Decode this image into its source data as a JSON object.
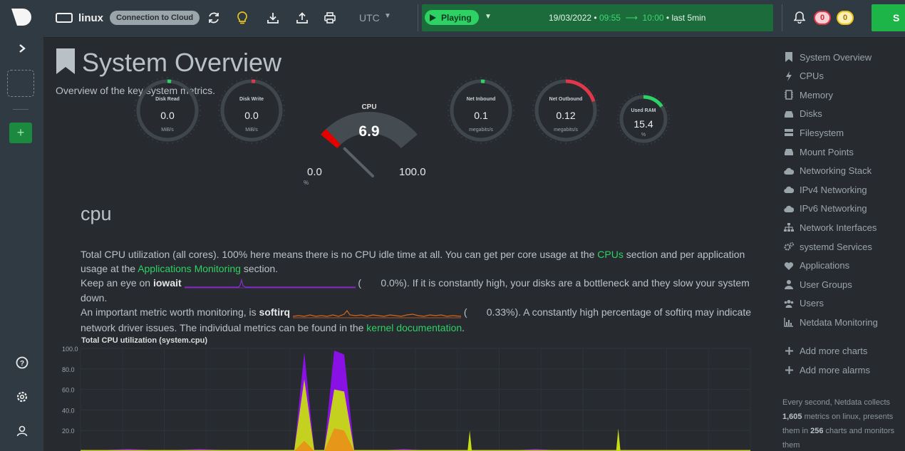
{
  "topbar": {
    "host": "linux",
    "cloud_badge": "Connection to Cloud",
    "timezone": "UTC",
    "play_label": "Playing",
    "date": "19/03/2022",
    "time_from": "09:55",
    "time_to": "10:00",
    "range": "last 5min",
    "alarms_critical": "0",
    "alarms_warning": "0",
    "signin_label": "S"
  },
  "colors": {
    "accent": "#2ed163",
    "critical": "#e0384a",
    "warning": "#e8c41c",
    "background": "#272b30"
  },
  "page": {
    "title": "System Overview",
    "subtitle": "Overview of the key system metrics."
  },
  "gauges": [
    {
      "label": "Disk Read",
      "value": "0.0",
      "unit": "MiB/s",
      "level": 0.0,
      "color": "#2ed163"
    },
    {
      "label": "Disk Write",
      "value": "0.0",
      "unit": "MiB/s",
      "level": 0.0,
      "color": "#e0384a"
    },
    {
      "label": "Net Inbound",
      "value": "0.1",
      "unit": "megabits/s",
      "level": 0.0,
      "color": "#2ed163"
    },
    {
      "label": "Net Outbound",
      "value": "0.12",
      "unit": "megabits/s",
      "level": 0.2,
      "color": "#e0384a"
    },
    {
      "label": "Used RAM",
      "value": "15.4",
      "unit": "%",
      "level": 0.154,
      "color": "#2ed163"
    }
  ],
  "cpu_gauge": {
    "label": "CPU",
    "value": "6.9",
    "min": "0.0",
    "max": "100.0",
    "unit": "%",
    "level": 0.069
  },
  "section": {
    "title": "cpu",
    "p1_a": "Total CPU utilization (all cores). 100% here means there is no CPU idle time at all. You can get per core usage at the ",
    "p1_link1": "CPUs",
    "p1_b": " section and per application usage at the ",
    "p1_link2": "Applications Monitoring",
    "p1_c": " section.",
    "p2_a": "Keep an eye on ",
    "p2_bold": "iowait",
    "p2_val": "0.0%",
    "p2_b": "). If it is constantly high, your disks are a bottleneck and they slow your system down.",
    "p3_a": "An important metric worth monitoring, is ",
    "p3_bold": "softirq",
    "p3_val": "0.33%",
    "p3_b": "). A constantly high percentage of softirq may indicate network driver issues. The individual metrics can be found in the ",
    "p3_link": "kernel documentation",
    "p3_c": "."
  },
  "chart_data": {
    "type": "area",
    "title": "Total CPU utilization (system.cpu)",
    "ylim": [
      0,
      100
    ],
    "yticks": [
      "100.0",
      "80.0",
      "60.0",
      "40.0",
      "20.0"
    ],
    "series": [
      {
        "name": "",
        "color": "#8a11e6",
        "values": [
          1,
          1,
          2,
          1,
          1,
          2,
          1,
          1,
          1,
          1,
          96,
          1,
          1,
          98,
          94,
          1,
          1,
          1,
          2,
          1,
          1,
          1,
          1,
          1,
          1,
          1,
          2,
          1,
          1,
          1,
          1,
          1,
          1,
          1,
          1,
          1,
          1,
          1,
          1,
          1
        ]
      },
      {
        "name": "",
        "color": "#c8dc14",
        "values": [
          1,
          1,
          1,
          1,
          1,
          1,
          1,
          1,
          1,
          1,
          70,
          1,
          1,
          60,
          58,
          1,
          1,
          1,
          1,
          1,
          1,
          1,
          1,
          1,
          1,
          1,
          1,
          1,
          1,
          1,
          1,
          1,
          1,
          1,
          1,
          1,
          1,
          1,
          1,
          1
        ]
      },
      {
        "name": "",
        "color": "#e8941a",
        "values": [
          0,
          0,
          0,
          0,
          0,
          0,
          0,
          0,
          0,
          0,
          10,
          0,
          0,
          22,
          20,
          0,
          0,
          0,
          0,
          0,
          0,
          0,
          0,
          0,
          0,
          0,
          0,
          0,
          0,
          0,
          0,
          0,
          0,
          0,
          0,
          0,
          0,
          0,
          0,
          0
        ]
      }
    ],
    "spikes": [
      {
        "index": 22,
        "value": 20
      },
      {
        "index": 31,
        "value": 22
      }
    ]
  },
  "nav": {
    "items": [
      {
        "label": "System Overview",
        "icon": "bookmark-icon"
      },
      {
        "label": "CPUs",
        "icon": "bolt-icon"
      },
      {
        "label": "Memory",
        "icon": "memory-icon"
      },
      {
        "label": "Disks",
        "icon": "disk-icon"
      },
      {
        "label": "Filesystem",
        "icon": "filesystem-icon"
      },
      {
        "label": "Mount Points",
        "icon": "mount-icon"
      },
      {
        "label": "Networking Stack",
        "icon": "cloud-icon"
      },
      {
        "label": "IPv4 Networking",
        "icon": "cloud-icon"
      },
      {
        "label": "IPv6 Networking",
        "icon": "cloud-icon"
      },
      {
        "label": "Network Interfaces",
        "icon": "sitemap-icon"
      },
      {
        "label": "systemd Services",
        "icon": "cogs-icon"
      },
      {
        "label": "Applications",
        "icon": "heartbeat-icon"
      },
      {
        "label": "User Groups",
        "icon": "user-icon"
      },
      {
        "label": "Users",
        "icon": "users-icon"
      },
      {
        "label": "Netdata Monitoring",
        "icon": "bar-chart-icon"
      }
    ],
    "add_charts": "Add more charts",
    "add_alarms": "Add more alarms",
    "note_a": "Every second, Netdata collects ",
    "note_metrics": "1,605",
    "note_b": " metrics on linux, presents them in ",
    "note_charts": "256",
    "note_c": " charts and monitors them"
  }
}
